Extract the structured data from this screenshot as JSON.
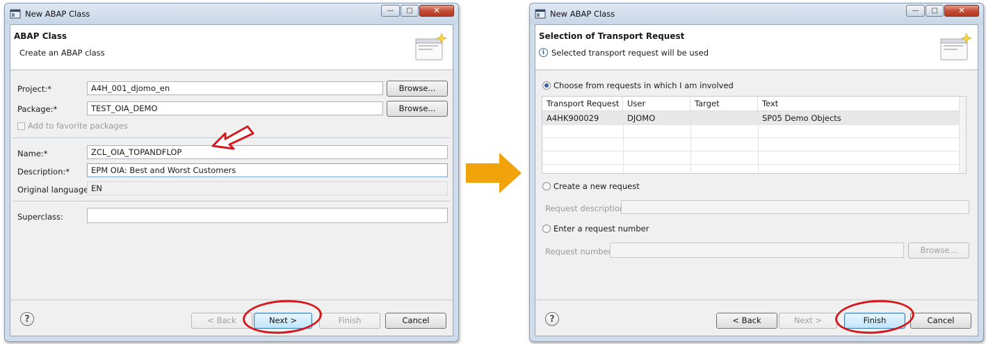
{
  "left_dialog": {
    "window_title": "New ABAP Class",
    "header_title": "ABAP Class",
    "header_subtitle": "Create an ABAP class",
    "project_label": "Project:*",
    "project_value": "A4H_001_djomo_en",
    "package_label": "Package:*",
    "package_value": "TEST_OIA_DEMO",
    "browse_label": "Browse...",
    "favorite_label": "Add to favorite packages",
    "name_label": "Name:*",
    "name_value": "ZCL_OIA_TOPANDFLOP",
    "description_label": "Description:*",
    "description_value": "EPM OIA: Best and Worst Customers",
    "orig_lang_label": "Original language:",
    "orig_lang_value": "EN",
    "superclass_label": "Superclass:",
    "superclass_value": "",
    "help": "?",
    "back_label": "< Back",
    "next_label": "Next >",
    "finish_label": "Finish",
    "cancel_label": "Cancel"
  },
  "right_dialog": {
    "window_title": "New ABAP Class",
    "header_title": "Selection of Transport Request",
    "header_subtitle": "Selected transport request will be used",
    "option_choose": "Choose from requests in which I am involved",
    "table": {
      "columns": [
        "Transport Request",
        "User",
        "Target",
        "Text"
      ],
      "rows": [
        [
          "A4HK900029",
          "DJOMO",
          "",
          "SP05 Demo Objects"
        ]
      ]
    },
    "option_new": "Create a new request",
    "request_description_label": "Request description:",
    "option_number": "Enter a request number",
    "request_number_label": "Request number:",
    "browse_label": "Browse...",
    "help": "?",
    "back_label": "< Back",
    "next_label": "Next >",
    "finish_label": "Finish",
    "cancel_label": "Cancel"
  },
  "colors": {
    "arrow": "#f0a30a",
    "highlight": "#d2191e"
  },
  "icons": [
    "window-icon",
    "wizard-icon",
    "info-icon",
    "help-icon",
    "transition-arrow-icon",
    "pointer-arrow-icon"
  ]
}
